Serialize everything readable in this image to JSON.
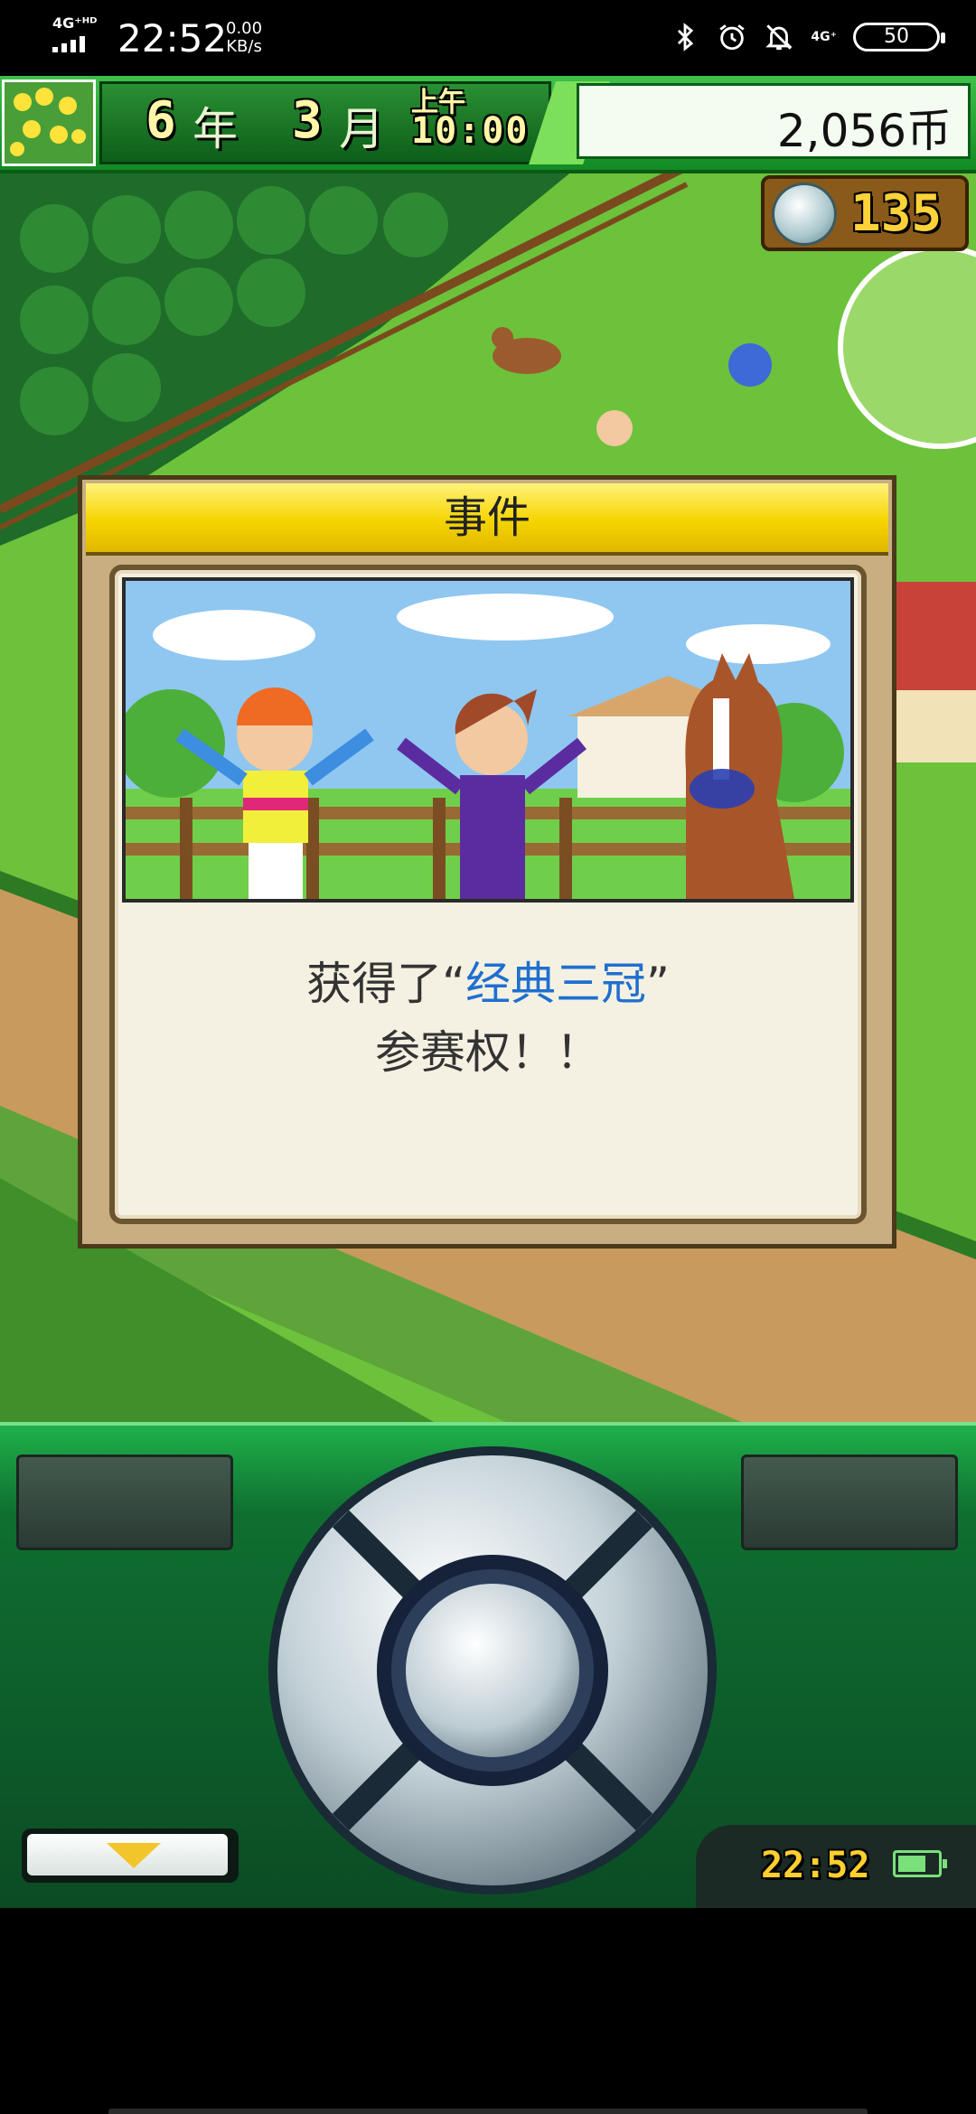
{
  "status_bar": {
    "network": "4G⁺ᴴᴰ",
    "time": "22:52",
    "speed_value": "0.00",
    "speed_unit": "KB/s",
    "right_network": "4G⁺",
    "battery": "50"
  },
  "hud": {
    "year_num": "6",
    "year_unit": "年",
    "month_num": "3",
    "month_unit": "月",
    "ampm": "上午",
    "clock": "10:00",
    "money": "2,056币",
    "medals": "135"
  },
  "dialog": {
    "title": "事件",
    "msg_prefix": "获得了“",
    "msg_highlight": "经典三冠",
    "msg_suffix": "”",
    "msg_line2": "参赛权！！"
  },
  "controller": {
    "panel_time": "22:52"
  },
  "colors": {
    "accent_green": "#1fb04a",
    "title_yellow": "#f5d400",
    "highlight_blue": "#1f6fd0"
  }
}
